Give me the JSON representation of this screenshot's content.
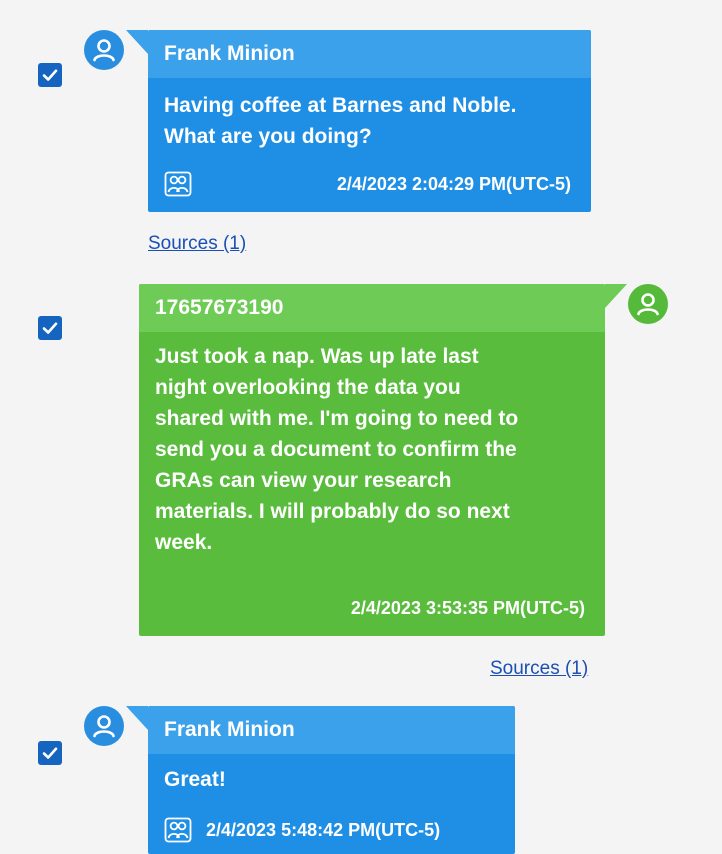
{
  "colors": {
    "incoming_bubble": "#1f8fe5",
    "incoming_header": "#3aa1ea",
    "outgoing_bubble": "#59bc3c",
    "outgoing_header": "#6ecb55",
    "checkbox": "#1565c0",
    "link": "#1a4fb5",
    "background": "#f4f4f4"
  },
  "messages": [
    {
      "direction": "incoming",
      "checked": true,
      "sender": "Frank Minion",
      "text_lines": [
        "Having coffee at Barnes and Noble.",
        "What are you doing?"
      ],
      "timestamp": "2/4/2023 2:04:29 PM(UTC-5)",
      "icons": [
        "user-avatar-icon",
        "group-participants-icon"
      ],
      "sources_label": "Sources (1)"
    },
    {
      "direction": "outgoing",
      "checked": true,
      "sender": "17657673190",
      "text_lines": [
        "Just took a nap. Was up late last",
        "night overlooking the data you",
        "shared with me. I'm going to need to",
        "send you a document to confirm the",
        "GRAs can view your research",
        "materials. I will probably do so next",
        "week."
      ],
      "timestamp": "2/4/2023 3:53:35 PM(UTC-5)",
      "icons": [
        "user-avatar-icon"
      ],
      "sources_label": "Sources (1)"
    },
    {
      "direction": "incoming",
      "checked": true,
      "sender": "Frank Minion",
      "text_lines": [
        "Great!"
      ],
      "timestamp": "2/4/2023 5:48:42 PM(UTC-5)",
      "icons": [
        "user-avatar-icon",
        "group-participants-icon"
      ]
    }
  ]
}
